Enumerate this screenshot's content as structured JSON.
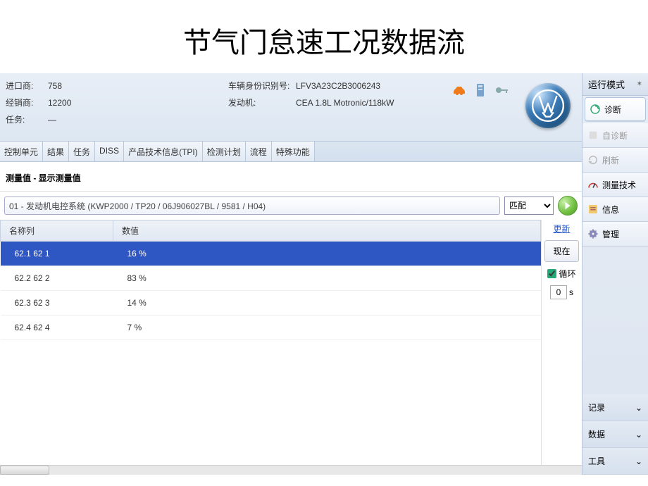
{
  "title": "节气门怠速工况数据流",
  "header": {
    "left": [
      {
        "label": "进口商:",
        "value": "758"
      },
      {
        "label": "经销商:",
        "value": "12200"
      },
      {
        "label": "任务:",
        "value": "—"
      }
    ],
    "right": [
      {
        "label": "车辆身份识别号:",
        "value": "LFV3A23C2B3006243"
      },
      {
        "label": "发动机:",
        "value": "CEA 1.8L Motronic/118kW"
      }
    ]
  },
  "tabs": [
    "控制单元",
    "结果",
    "任务",
    "DISS",
    "产品技术信息(TPI)",
    "检测计划",
    "流程",
    "特殊功能"
  ],
  "measure_title": "测量值 - 显示测量值",
  "system_select": "01 - 发动机电控系统 (KWP2000 / TP20 / 06J906027BL / 9581 / H04)",
  "match_label": "匹配",
  "table": {
    "cols": [
      "名称列",
      "数值"
    ],
    "rows": [
      {
        "name": "62.1 62 1",
        "value": "16 %",
        "selected": true
      },
      {
        "name": "62.2 62 2",
        "value": "83 %"
      },
      {
        "name": "62.3 62 3",
        "value": "14 %"
      },
      {
        "name": "62.4 62 4",
        "value": "7 %"
      }
    ]
  },
  "ctrl": {
    "update": "更新",
    "now": "现在",
    "loop": "循环",
    "interval": "0",
    "unit": "s"
  },
  "sidebar": {
    "mode": "运行模式",
    "items": [
      {
        "id": "diagnosis",
        "label": "诊断",
        "state": "active"
      },
      {
        "id": "self-diagnosis",
        "label": "自诊断",
        "state": "disabled"
      },
      {
        "id": "refresh",
        "label": "刷新",
        "state": "disabled"
      },
      {
        "id": "measure-tech",
        "label": "测量技术",
        "state": ""
      },
      {
        "id": "info",
        "label": "信息",
        "state": ""
      },
      {
        "id": "manage",
        "label": "管理",
        "state": ""
      }
    ],
    "sections": [
      "记录",
      "数据",
      "工具"
    ]
  }
}
